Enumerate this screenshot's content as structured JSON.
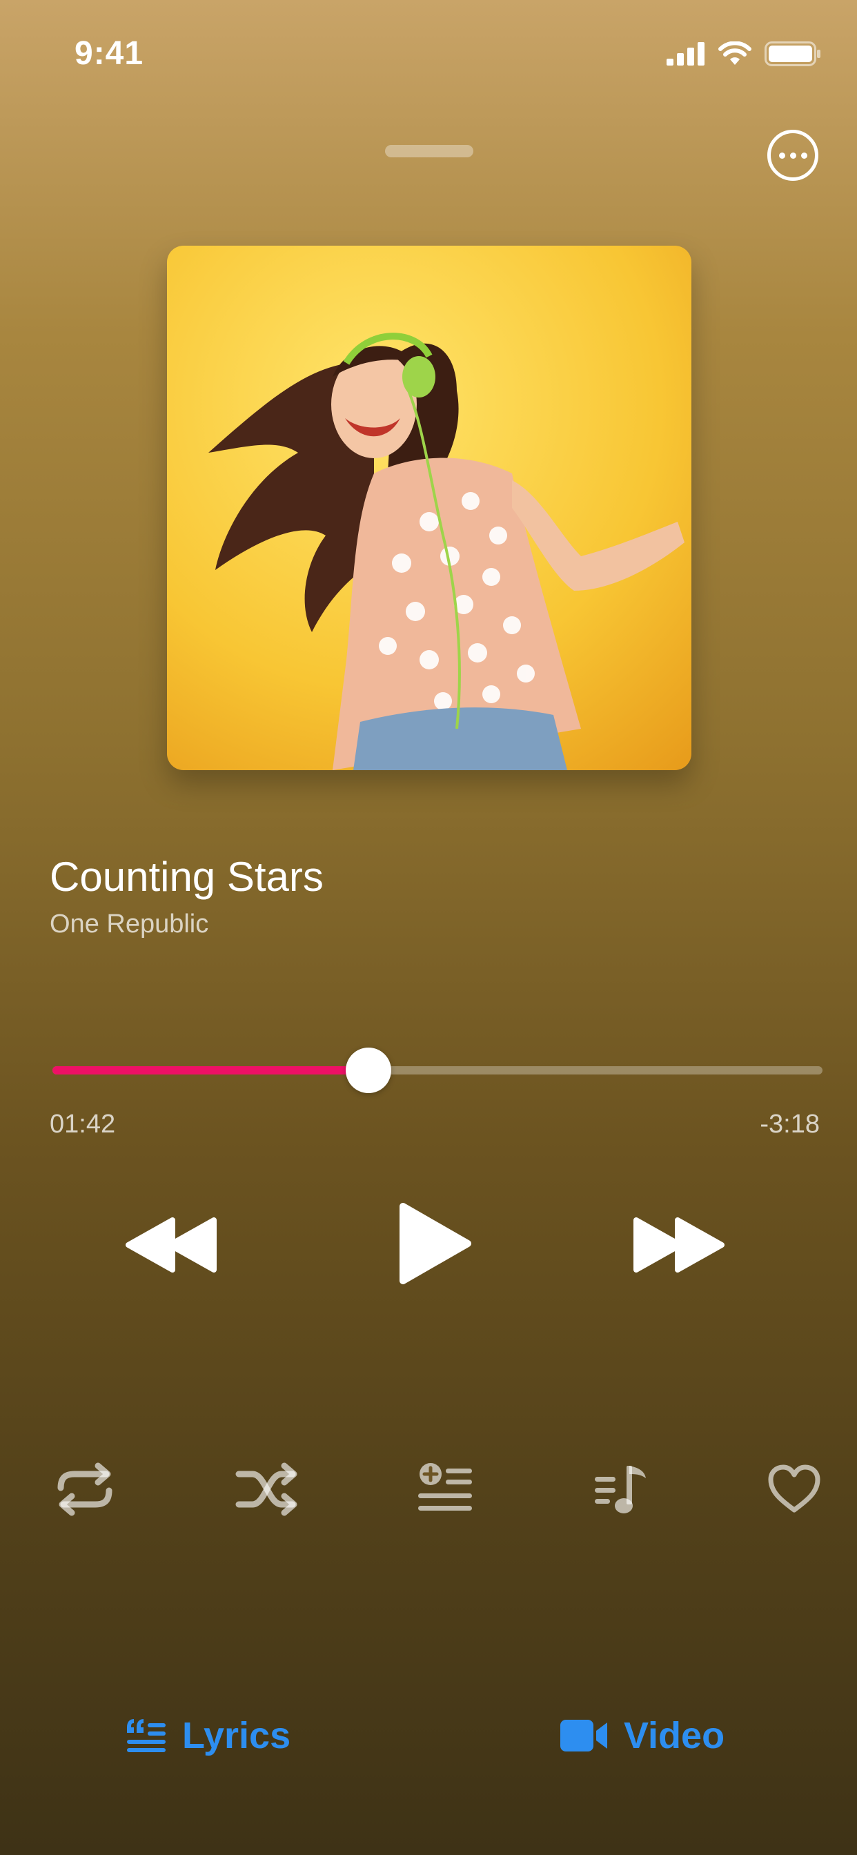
{
  "status_bar": {
    "time": "9:41"
  },
  "now_playing": {
    "title": "Counting Stars",
    "artist": "One Republic",
    "elapsed": "01:42",
    "remaining": "-3:18",
    "progress_fraction": 0.41
  },
  "controls": {
    "rewind_icon": "rewind-icon",
    "play_icon": "play-icon",
    "fast_forward_icon": "fast-forward-icon"
  },
  "actions": [
    "repeat-icon",
    "shuffle-icon",
    "add-to-queue-icon",
    "playlist-icon",
    "heart-icon"
  ],
  "bottom_tabs": {
    "lyrics_label": "Lyrics",
    "video_label": "Video"
  },
  "colors": {
    "accent": "#2d8ef0",
    "progress": "#ee1166"
  }
}
